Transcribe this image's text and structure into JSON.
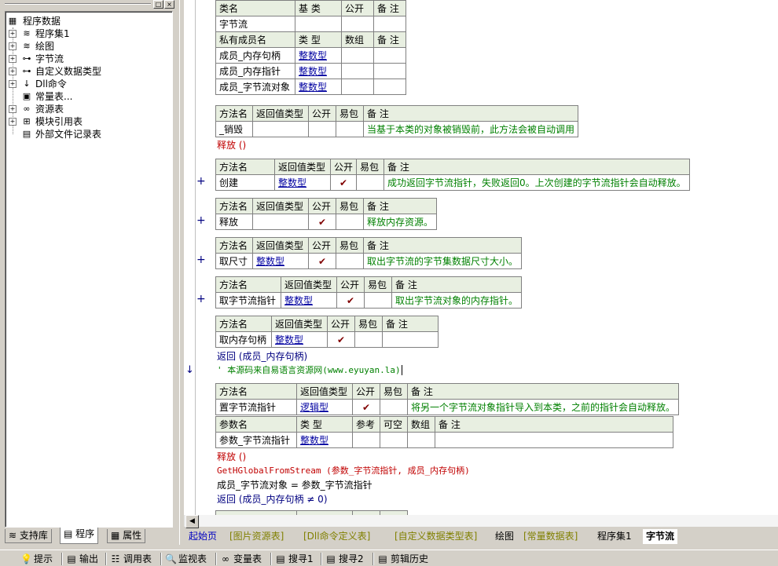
{
  "tree": {
    "root": "程序数据",
    "items": [
      {
        "label": "程序集1",
        "icon": "stack-icon",
        "expand": "+"
      },
      {
        "label": "绘图",
        "icon": "stack-icon",
        "expand": "+"
      },
      {
        "label": "字节流",
        "icon": "class-icon",
        "expand": "+"
      },
      {
        "label": "自定义数据类型",
        "icon": "datatype-icon",
        "expand": "+"
      },
      {
        "label": "Dll命令",
        "icon": "dll-icon",
        "expand": "+"
      },
      {
        "label": "常量表...",
        "icon": "const-icon",
        "expand": ""
      },
      {
        "label": "资源表",
        "icon": "resource-icon",
        "expand": "+"
      },
      {
        "label": "模块引用表",
        "icon": "module-icon",
        "expand": "+"
      },
      {
        "label": "外部文件记录表",
        "icon": "file-icon",
        "expand": ""
      }
    ]
  },
  "left_tabs": [
    "支持库",
    "程序",
    "属性"
  ],
  "class_table": {
    "headers": [
      "类名",
      "基 类",
      "公开",
      "备 注"
    ],
    "row": [
      "字节流",
      "",
      "",
      ""
    ],
    "member_headers": [
      "私有成员名",
      "类 型",
      "数组",
      "备 注"
    ],
    "members": [
      [
        "成员_内存句柄",
        "整数型",
        "",
        ""
      ],
      [
        "成员_内存指针",
        "整数型",
        "",
        ""
      ],
      [
        "成员_字节流对象",
        "整数型",
        "",
        ""
      ]
    ]
  },
  "method_headers": [
    "方法名",
    "返回值类型",
    "公开",
    "易包",
    "备 注"
  ],
  "methods": [
    {
      "name": "_销毁",
      "ret": "",
      "public": "",
      "note": "当基于本类的对象被销毁前，此方法会被自动调用",
      "plus": ""
    },
    {
      "name": "创建",
      "ret": "整数型",
      "public": "✔",
      "note": "成功返回字节流指针，失败返回0。上次创建的字节流指针会自动释放。",
      "plus": "+"
    },
    {
      "name": "释放",
      "ret": "",
      "public": "✔",
      "note": "释放内存资源。",
      "plus": "+"
    },
    {
      "name": "取尺寸",
      "ret": "整数型",
      "public": "✔",
      "note": "取出字节流的字节集数据尺寸大小。",
      "plus": "+"
    },
    {
      "name": "取字节流指针",
      "ret": "整数型",
      "public": "✔",
      "note": "取出字节流对象的内存指针。",
      "plus": "+"
    },
    {
      "name": "取内存句柄",
      "ret": "整数型",
      "public": "✔",
      "note": "",
      "plus": ""
    },
    {
      "name": "置字节流指针",
      "ret": "逻辑型",
      "public": "✔",
      "note": "将另一个字节流对象指针导入到本类，之前的指针会自动释放。",
      "plus": ""
    }
  ],
  "code": {
    "release_call": "释放 ()",
    "return_handle": "返回 (成员_内存句柄)",
    "comment": "' 本源码来自易语言资源网(www.eyuyan.la)",
    "release_call2": "释放 ()",
    "api_call": "GetHGlobalFromStream (参数_字节流指针, 成员_内存句柄)",
    "assign": "成员_字节流对象 = 参数_字节流指针",
    "return_ne": "返回 (成员_内存句柄 ≠ 0)"
  },
  "param_headers": [
    "参数名",
    "类 型",
    "参考",
    "可空",
    "数组",
    "备 注"
  ],
  "param_row": [
    "参数_字节流指针",
    "整数型",
    "",
    "",
    "",
    ""
  ],
  "doc_tabs": [
    "起始页",
    "[图片资源表]",
    "[Dll命令定义表]",
    "[自定义数据类型表]",
    "绘图",
    "[常量数据表]",
    "程序集1",
    "字节流"
  ],
  "tool_tabs": [
    {
      "label": "提示",
      "icon": "hint-icon"
    },
    {
      "label": "输出",
      "icon": "output-icon"
    },
    {
      "label": "调用表",
      "icon": "calltable-icon"
    },
    {
      "label": "监视表",
      "icon": "watch-icon"
    },
    {
      "label": "变量表",
      "icon": "variable-icon"
    },
    {
      "label": "搜寻1",
      "icon": "search1-icon"
    },
    {
      "label": "搜寻2",
      "icon": "search2-icon"
    },
    {
      "label": "剪辑历史",
      "icon": "clip-history-icon"
    }
  ]
}
